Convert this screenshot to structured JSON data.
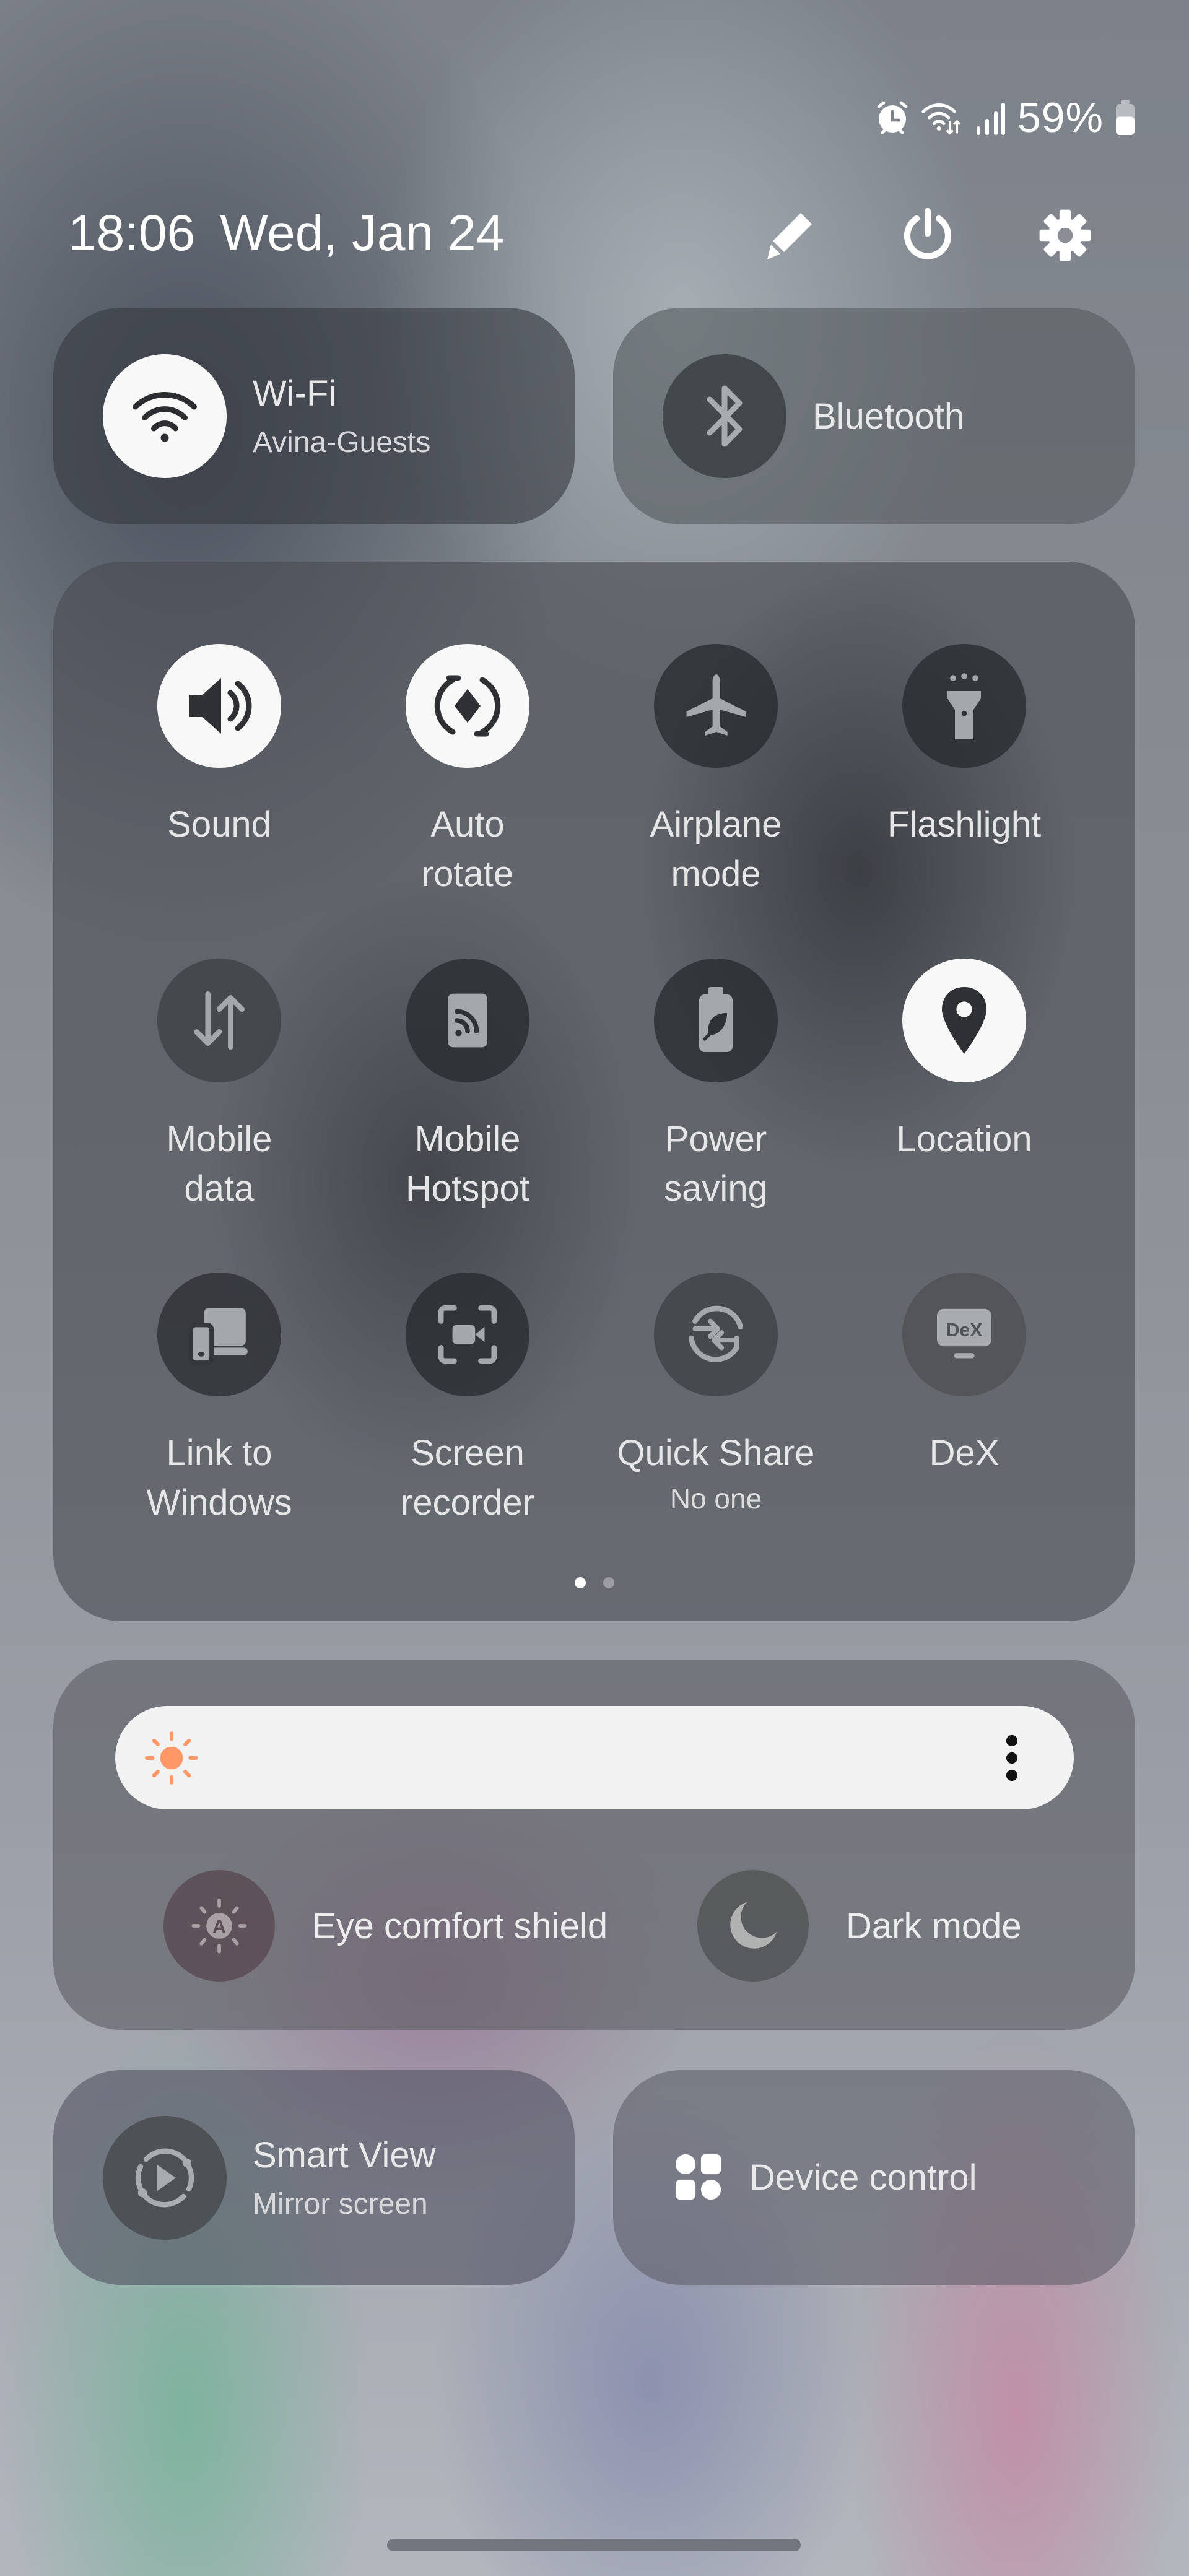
{
  "status_bar": {
    "icons": [
      "alarm-icon",
      "wifi-data-icon",
      "signal-icon",
      "battery-icon"
    ],
    "battery_percent_text": "59%",
    "battery_level": 0.59
  },
  "header": {
    "time": "18:06",
    "date": "Wed, Jan 24",
    "buttons": [
      {
        "name": "edit",
        "icon": "pencil-icon"
      },
      {
        "name": "power",
        "icon": "power-icon"
      },
      {
        "name": "settings",
        "icon": "gear-icon"
      }
    ]
  },
  "top_cards": {
    "wifi": {
      "title": "Wi-Fi",
      "subtitle": "Avina-Guests",
      "state": "on",
      "icon": "wifi-icon"
    },
    "bluetooth": {
      "title": "Bluetooth",
      "state": "off",
      "icon": "bluetooth-icon"
    }
  },
  "tiles": [
    {
      "label": "Sound",
      "icon": "speaker-icon",
      "state": "on"
    },
    {
      "label": "Auto\nrotate",
      "icon": "auto-rotate-icon",
      "state": "on"
    },
    {
      "label": "Airplane\nmode",
      "icon": "airplane-icon",
      "state": "off"
    },
    {
      "label": "Flashlight",
      "icon": "flashlight-icon",
      "state": "off"
    },
    {
      "label": "Mobile\ndata",
      "icon": "mobile-data-icon",
      "state": "off"
    },
    {
      "label": "Mobile\nHotspot",
      "icon": "hotspot-icon",
      "state": "off"
    },
    {
      "label": "Power\nsaving",
      "icon": "power-saving-icon",
      "state": "off"
    },
    {
      "label": "Location",
      "icon": "location-pin-icon",
      "state": "on"
    },
    {
      "label": "Link to\nWindows",
      "icon": "link-to-windows-icon",
      "state": "off"
    },
    {
      "label": "Screen\nrecorder",
      "icon": "screen-recorder-icon",
      "state": "off"
    },
    {
      "label": "Quick Share",
      "sublabel": "No one",
      "icon": "quick-share-icon",
      "state": "off"
    },
    {
      "label": "DeX",
      "icon": "dex-icon",
      "icon_text": "DeX",
      "state": "off"
    }
  ],
  "pager": {
    "pages": 2,
    "current": 1
  },
  "brightness": {
    "icon": "sun-icon",
    "accent_color": "#ff9766",
    "more_icon": "more-vertical-icon",
    "toggles": [
      {
        "label": "Eye comfort shield",
        "icon": "eye-comfort-icon",
        "icon_text": "A",
        "state": "off"
      },
      {
        "label": "Dark mode",
        "icon": "moon-icon",
        "state": "off"
      }
    ]
  },
  "bottom_cards": {
    "smart_view": {
      "title": "Smart View",
      "subtitle": "Mirror screen",
      "icon": "smart-view-icon"
    },
    "device_control": {
      "title": "Device control",
      "icon": "device-control-icon"
    }
  }
}
